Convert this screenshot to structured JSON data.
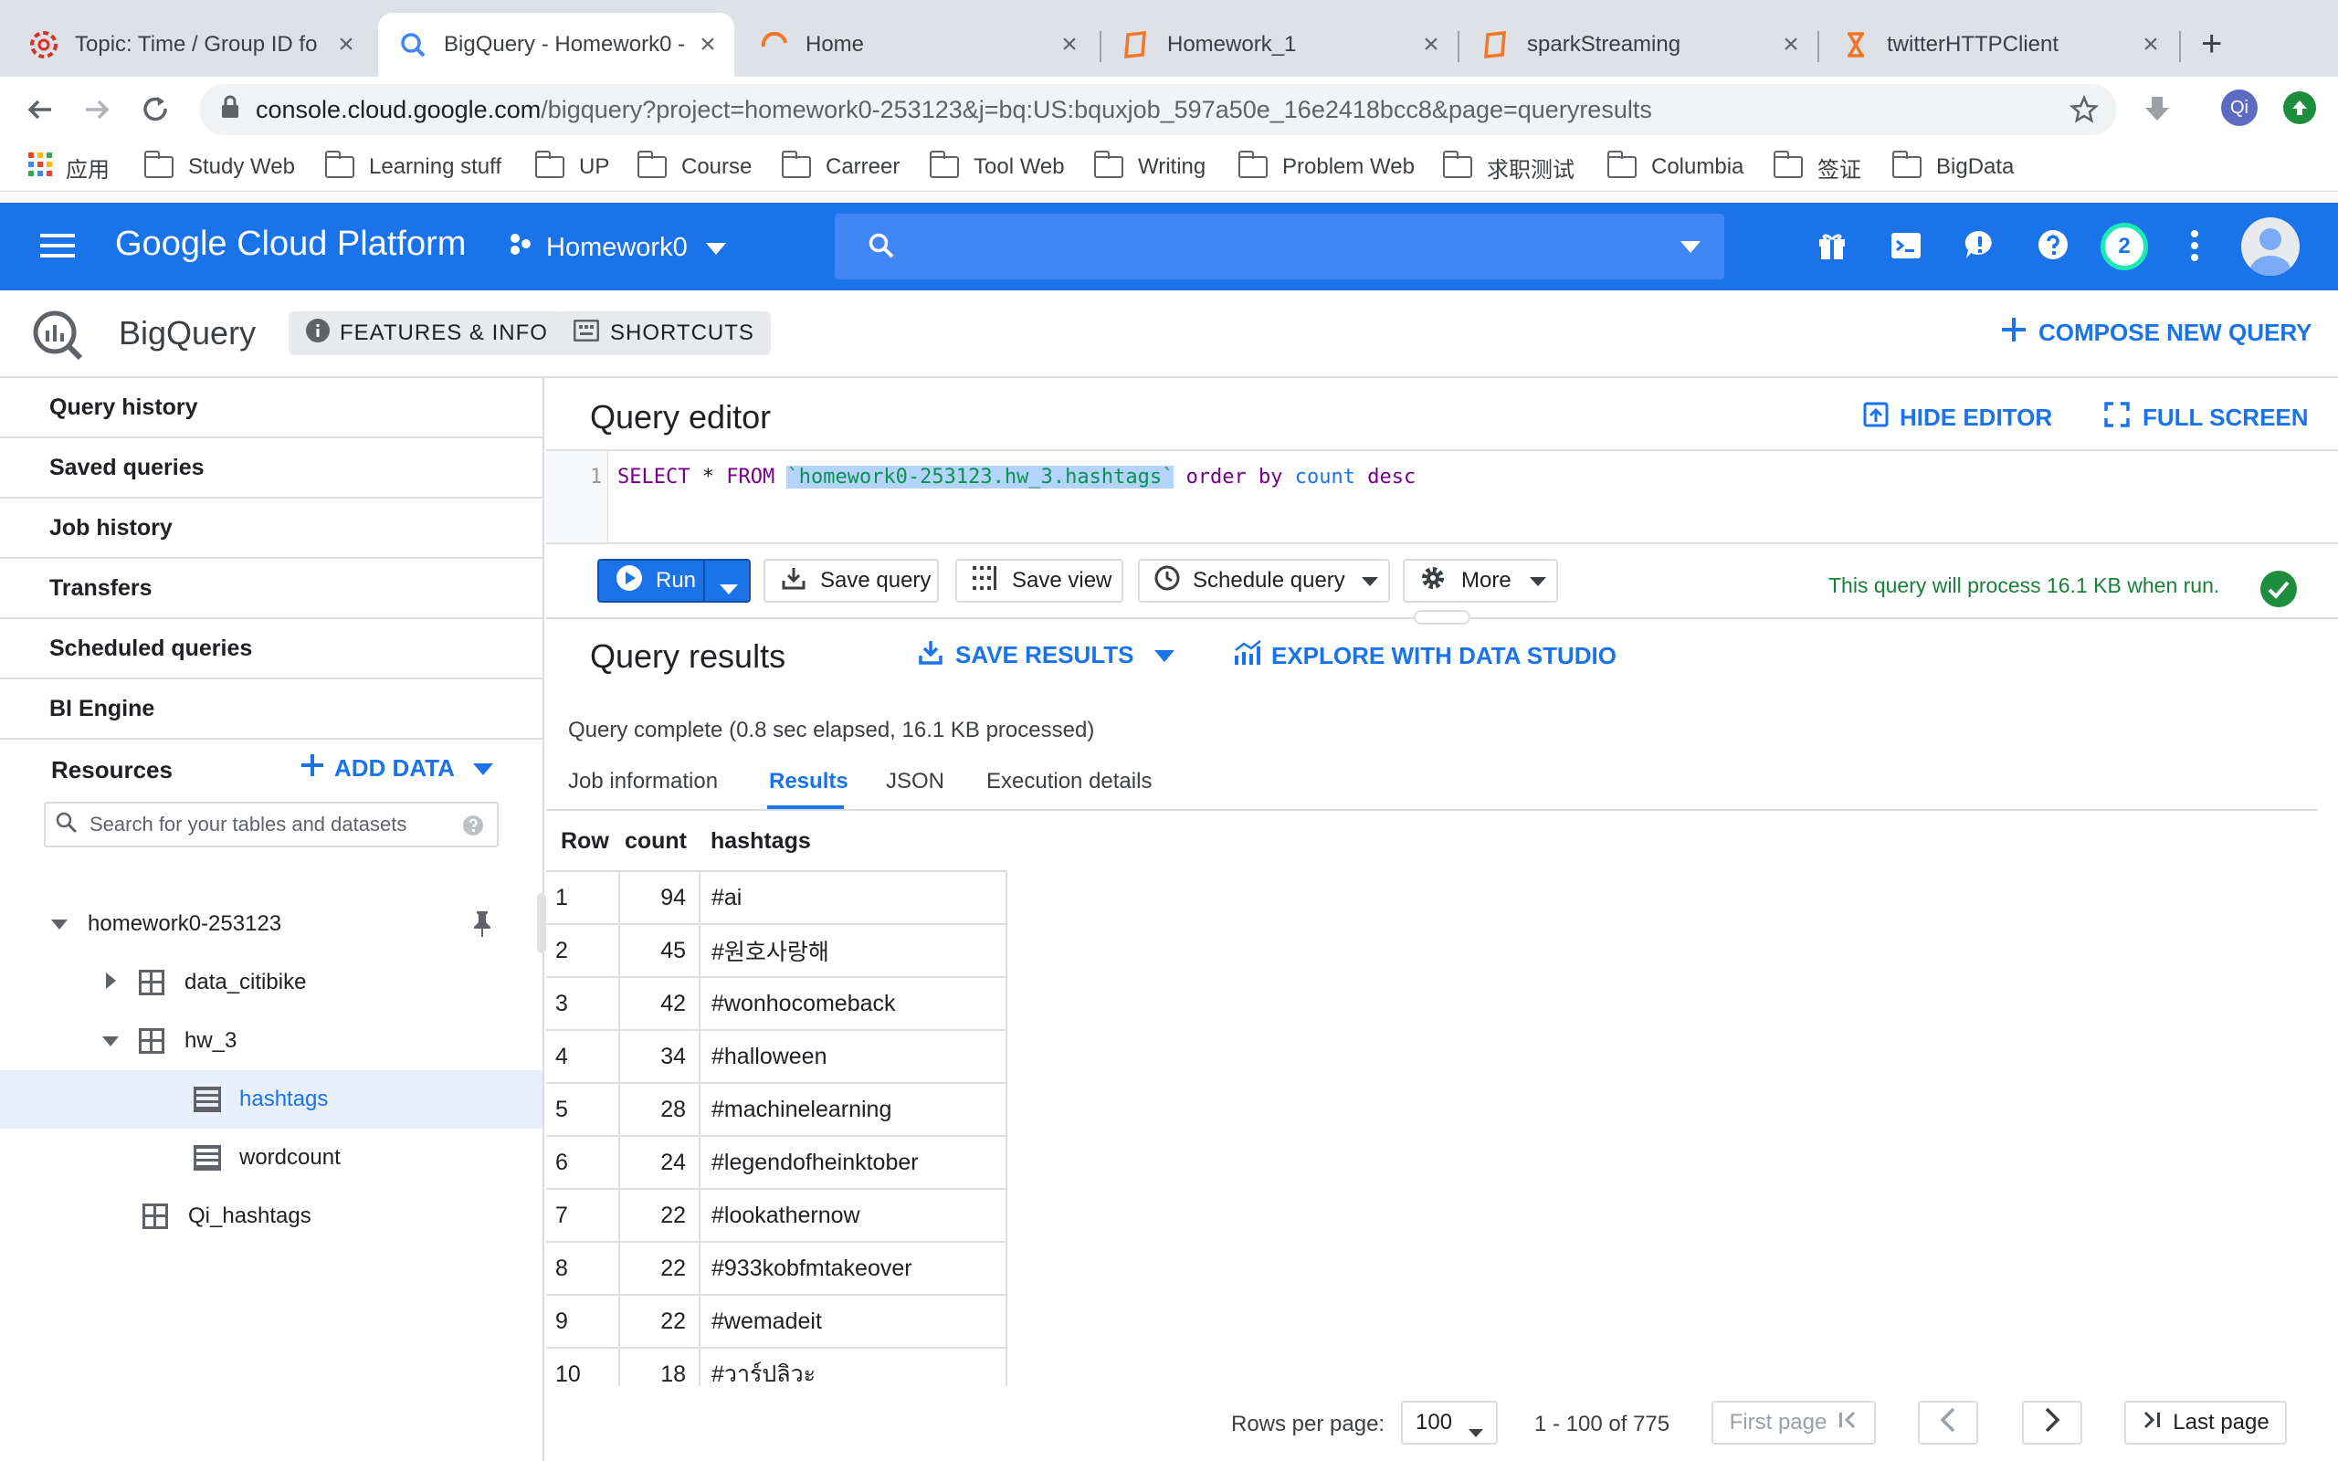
{
  "browser": {
    "tabs": [
      {
        "title": "Topic: Time / Group ID fo",
        "icon": "help-icon"
      },
      {
        "title": "BigQuery - Homework0 -",
        "icon": "bigquery-icon"
      },
      {
        "title": "Home",
        "icon": "home-icon"
      },
      {
        "title": "Homework_1",
        "icon": "notebook-icon"
      },
      {
        "title": "sparkStreaming",
        "icon": "notebook-icon"
      },
      {
        "title": "twitterHTTPClient",
        "icon": "hourglass-icon"
      }
    ],
    "new_tab": "+",
    "url_host": "console.cloud.google.com",
    "url_path": "/bigquery?project=homework0-253123&j=bq:US:bquxjob_597a50e_16e2418bcc8&page=queryresults",
    "profile_initials": "Qi",
    "bookmarks": [
      "应用",
      "Study Web",
      "Learning stuff",
      "UP",
      "Course",
      "Carreer",
      "Tool Web",
      "Writing",
      "Problem Web",
      "求职测试",
      "Columbia",
      "签证",
      "BigData"
    ]
  },
  "gcp": {
    "brand": "Google Cloud Platform",
    "project": "Homework0",
    "notifications_count": "2"
  },
  "bq": {
    "product": "BigQuery",
    "features_label": "FEATURES & INFO",
    "shortcuts_label": "SHORTCUTS",
    "compose_label": "COMPOSE NEW QUERY"
  },
  "sidebar": {
    "items": [
      "Query history",
      "Saved queries",
      "Job history",
      "Transfers",
      "Scheduled queries",
      "BI Engine"
    ],
    "resources_label": "Resources",
    "add_data_label": "ADD DATA",
    "search_placeholder": "Search for your tables and datasets",
    "project": "homework0-253123",
    "tree": [
      {
        "label": "data_citibike",
        "type": "dataset"
      },
      {
        "label": "hw_3",
        "type": "dataset"
      },
      {
        "label": "hashtags",
        "type": "table"
      },
      {
        "label": "wordcount",
        "type": "table"
      },
      {
        "label": "Qi_hashtags",
        "type": "dataset"
      }
    ]
  },
  "editor": {
    "title": "Query editor",
    "hide_label": "HIDE EDITOR",
    "fullscreen_label": "FULL SCREEN",
    "line_number": "1",
    "sql_select": "SELECT",
    "sql_star": "*",
    "sql_from": "FROM",
    "sql_table": "`homework0-253123.hw_3.hashtags`",
    "sql_order": "order",
    "sql_by": "by",
    "sql_count": "count",
    "sql_desc": "desc",
    "run_label": "Run",
    "save_query_label": "Save query",
    "save_view_label": "Save view",
    "schedule_label": "Schedule query",
    "more_label": "More",
    "validator_text": "This query will process 16.1 KB when run."
  },
  "results": {
    "title": "Query results",
    "save_results_label": "SAVE RESULTS",
    "explore_label": "EXPLORE WITH DATA STUDIO",
    "status": "Query complete (0.8 sec elapsed, 16.1 KB processed)",
    "tabs": [
      "Job information",
      "Results",
      "JSON",
      "Execution details"
    ],
    "columns": [
      "Row",
      "count",
      "hashtags"
    ],
    "rows": [
      [
        "1",
        "94",
        "#ai"
      ],
      [
        "2",
        "45",
        "#원호사랑해"
      ],
      [
        "3",
        "42",
        "#wonhocomeback"
      ],
      [
        "4",
        "34",
        "#halloween"
      ],
      [
        "5",
        "28",
        "#machinelearning"
      ],
      [
        "6",
        "24",
        "#legendofheinktober"
      ],
      [
        "7",
        "22",
        "#lookathernow"
      ],
      [
        "8",
        "22",
        "#933kobfmtakeover"
      ],
      [
        "9",
        "22",
        "#wemadeit"
      ],
      [
        "10",
        "18",
        "#วาร์ปลิวะ"
      ]
    ],
    "rows_per_page_label": "Rows per page:",
    "rows_per_page": "100",
    "range": "1 - 100 of 775",
    "first_page_label": "First page",
    "last_page_label": "Last page"
  }
}
